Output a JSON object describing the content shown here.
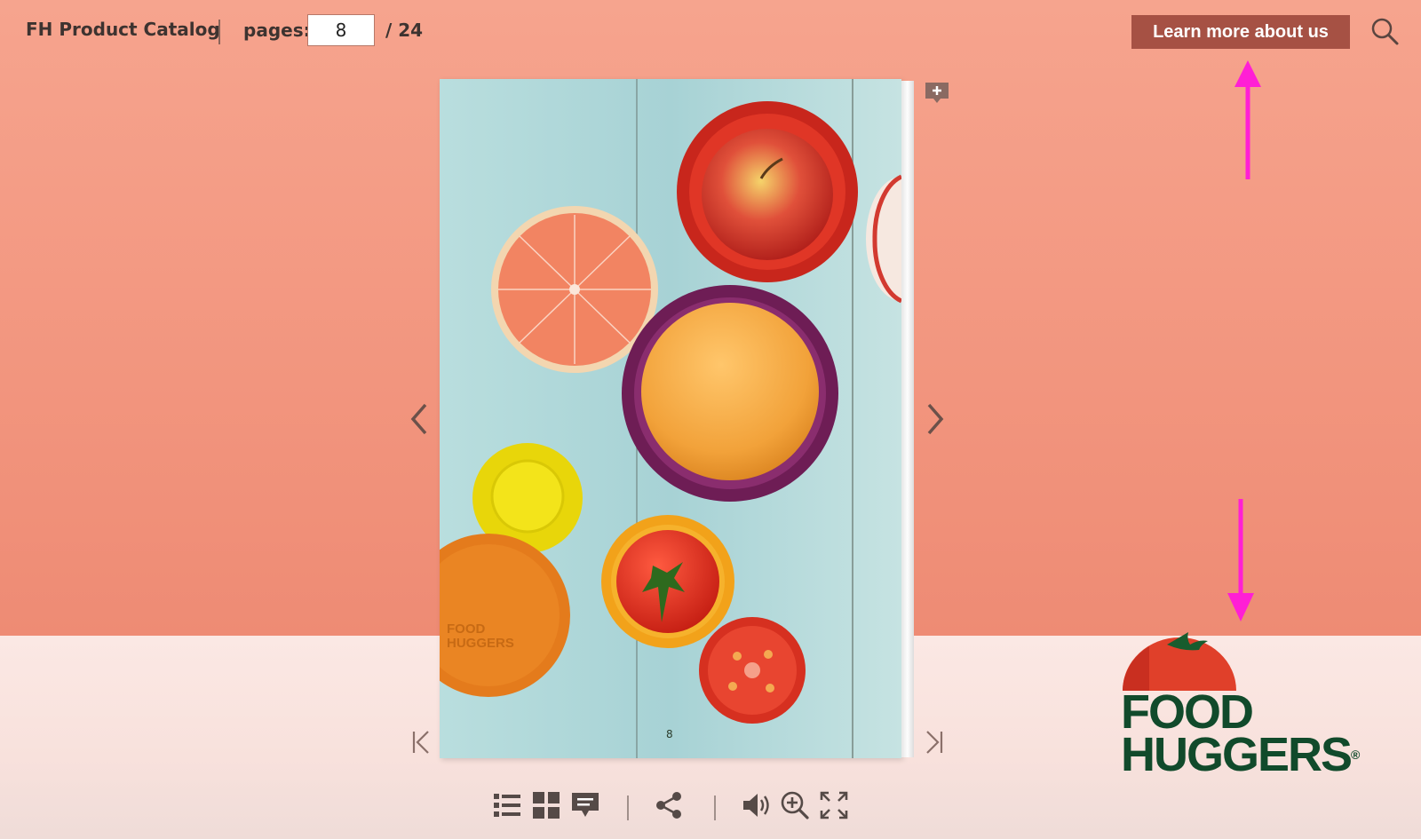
{
  "header": {
    "title": "FH Product Catalog",
    "pages_label": "pages:",
    "current_page": "8",
    "total_pages": "/ 24",
    "learn_more_label": "Learn more about us"
  },
  "icons": {
    "search": "search-icon",
    "add_comment": "add-comment-icon",
    "prev": "chevron-left-icon",
    "next": "chevron-right-icon",
    "first": "first-page-icon",
    "last": "last-page-icon",
    "toc": "list-icon",
    "thumbnails": "grid-icon",
    "comments": "comment-icon",
    "share": "share-icon",
    "sound": "speaker-icon",
    "zoom": "zoom-in-icon",
    "fullscreen": "fullscreen-icon"
  },
  "book": {
    "page_number": "8",
    "pictured_brand": [
      "FOOD",
      "HUGGERS"
    ]
  },
  "logo": {
    "line1": "FOOD",
    "line2": "HUGGERS",
    "mark": "®"
  },
  "colors": {
    "background_top": "#f2957e",
    "background_bottom": "#f8e1dc",
    "button": "#a65144",
    "logo_green": "#114a2b",
    "logo_red": "#e0402a",
    "annotation_arrow": "#ff1fd5"
  }
}
